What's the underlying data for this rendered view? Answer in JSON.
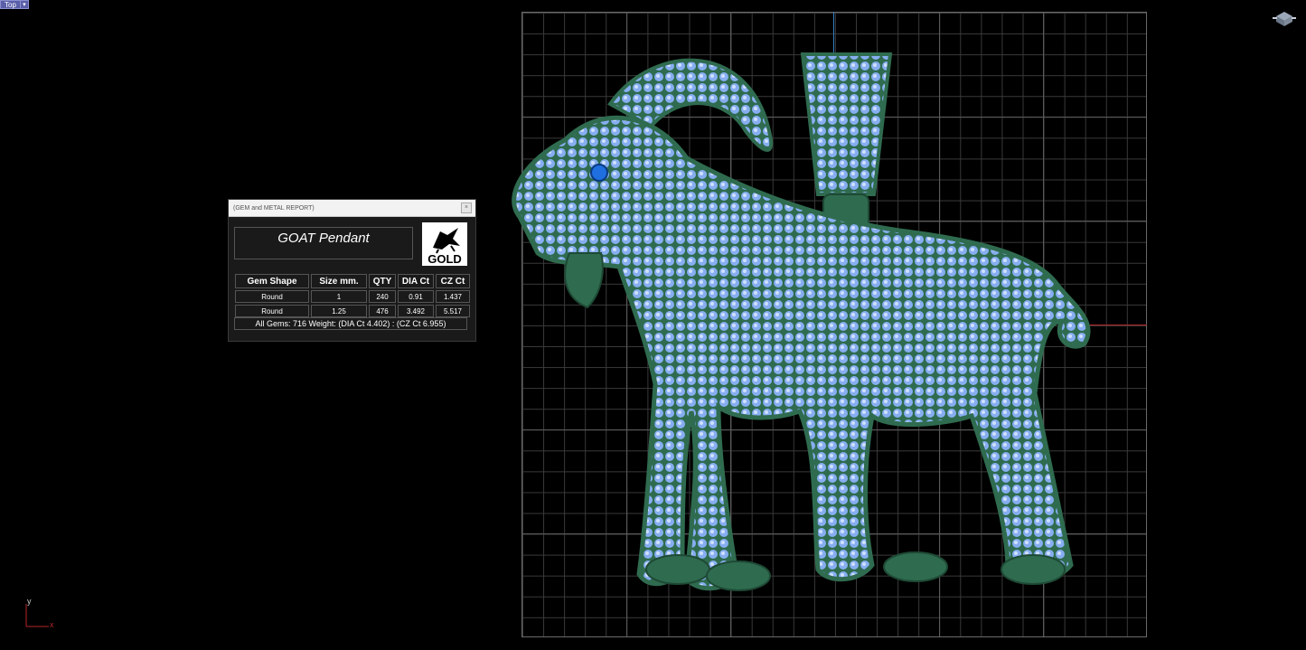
{
  "viewport": {
    "name": "Top",
    "dropdown": "▾"
  },
  "report": {
    "window_title": "(GEM and METAL REPORT)",
    "close": "×",
    "product_title": "GOAT Pendant",
    "logo_text": "GOLD",
    "headers": [
      "Gem Shape",
      "Size mm.",
      "QTY",
      "DIA Ct",
      "CZ Ct"
    ],
    "rows": [
      [
        "Round",
        "1",
        "240",
        "0.91",
        "1.437"
      ],
      [
        "Round",
        "1.25",
        "476",
        "3.492",
        "5.517"
      ]
    ],
    "summary": "All Gems: 716  Weight: (DIA Ct 4.402) : (CZ Ct 6.955)"
  },
  "axes": {
    "y": "y",
    "x": "x"
  },
  "colors": {
    "gem": "#7fa8e8",
    "metal": "#2f6b4f",
    "eye": "#1f6fe0",
    "grid": "#3a3a3a",
    "x_axis": "#b3262c",
    "y_axis": "#3a7fc2"
  }
}
